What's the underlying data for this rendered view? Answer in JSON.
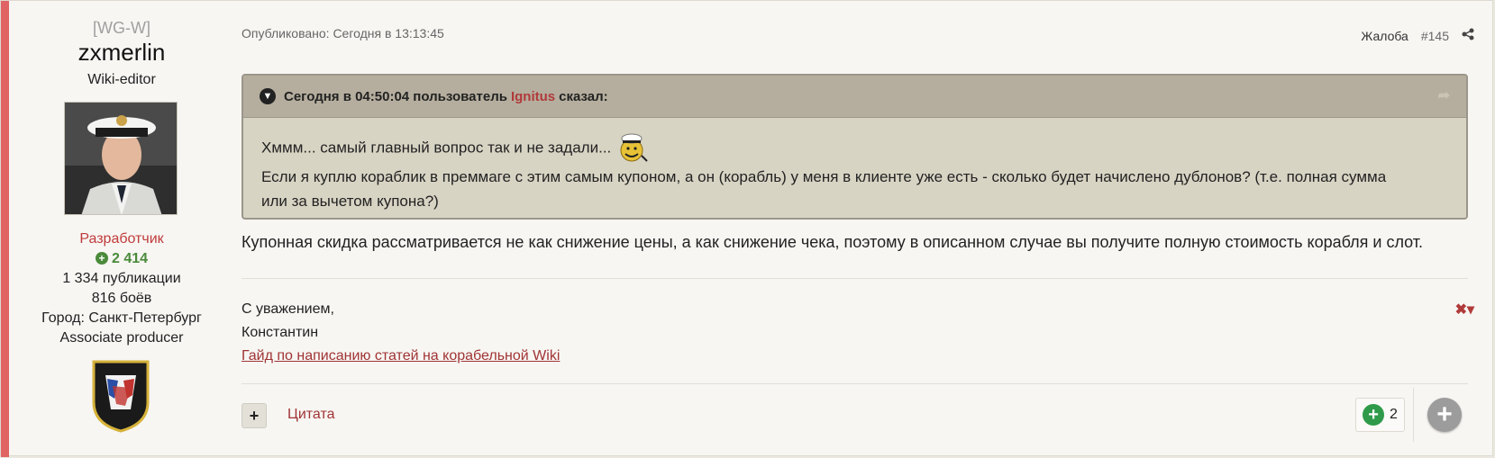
{
  "author": {
    "clan": "[WG-W]",
    "name": "zxmerlin",
    "title": "Wiki-editor",
    "role": "Разработчик",
    "reputation": "2 414",
    "stats": [
      "1 334 публикации",
      "816 боёв",
      "Город: Санкт-Петербург",
      "Associate producer"
    ]
  },
  "post": {
    "published": "Опубликовано: Сегодня в 13:13:45",
    "report": "Жалоба",
    "number": "#145",
    "quote": {
      "header_prefix": "Сегодня в 04:50:04 пользователь",
      "user": "Ignitus",
      "header_suffix": "сказал:",
      "line1": "Хммм... самый главный вопрос так и не задали...",
      "line2": "Если я куплю кораблик в преммаге с этим самым купоном, а он (корабль) у меня в клиенте уже есть - сколько будет начислено дублонов? (т.е. полная сумма",
      "line3": "или за вычетом купона?)"
    },
    "answer": "Купонная скидка рассматривается не как снижение цены, а как снижение чека, поэтому в описанном случае вы получите полную стоимость корабля и слот.",
    "signature": {
      "line1": "С уважением,",
      "line2": "Константин",
      "link": "Гайд по написанию статей на корабельной Wiki"
    },
    "cite_label": "Цитата",
    "reaction_count": "2"
  },
  "colors": {
    "accent": "#e06464",
    "link": "#a03434",
    "quote_header": "#b5ae9e",
    "quote_body": "#d8d4c4"
  },
  "icons": [
    "share-icon",
    "chevron-down-icon",
    "reply-share-icon",
    "close-icon",
    "plus-icon",
    "reaction-plus-icon"
  ]
}
